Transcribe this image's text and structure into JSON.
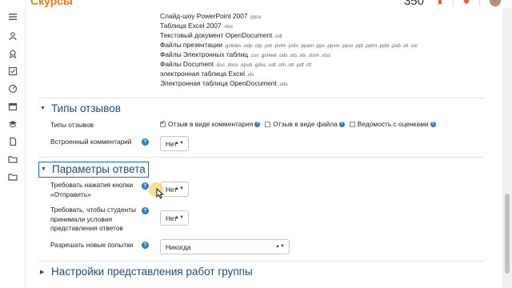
{
  "header": {
    "logo_text": "Скурсы",
    "counter": "350"
  },
  "file_types": [
    {
      "name": "Слайд-шоу PowerPoint 2007",
      "ext": ".ppsx"
    },
    {
      "name": "Таблица Excel 2007",
      "ext": ".xlsx"
    },
    {
      "name": "Текстовый документ OpenDocument",
      "ext": ".odt"
    },
    {
      "name": "Файлы презентации",
      "ext": ".gslides .odp .otp .pot .potm .potx .ppam .pps .ppsm .ppsx .ppt .pptm .pptx .pub .sti .sxi"
    },
    {
      "name": "Файлы Электронных таблиц",
      "ext": ".csv .gsheet .ods .ots .xls .xlsm .xlsx"
    },
    {
      "name": "Файлы Document",
      "ext": ".doc .docx .epub .gdoc .odt .oth .ott .pdf .rtf"
    },
    {
      "name": "электронная таблица Excel",
      "ext": ".xls"
    },
    {
      "name": "Электронная таблица OpenDocument",
      "ext": ".ods"
    }
  ],
  "feedback_section": {
    "title": "Типы отзывов",
    "types_label": "Типы отзывов",
    "options": [
      {
        "label": "Отзыв в виде комментария",
        "checked": true
      },
      {
        "label": "Отзыв в виде файла",
        "checked": false
      },
      {
        "label": "Ведомость с оценками",
        "checked": false
      }
    ],
    "inline_comment_label": "Встроенный комментарий",
    "inline_comment_value": "Нет"
  },
  "submission_section": {
    "title": "Параметры ответа",
    "require_submit_label": "Требовать нажатия кнопки «Отправить»",
    "require_submit_value": "Нет",
    "require_accept_label": "Требовать, чтобы студенты принимали условия представления ответов",
    "require_accept_value": "Нет",
    "attempts_label": "Разрешать новые попытки",
    "attempts_value": "Никогда"
  },
  "group_section": {
    "title": "Настройки представления работ группы"
  },
  "colors": {
    "accent": "#1a6fb8",
    "heading": "#1a4e7a",
    "help_icon": "#2b7cc0",
    "logo": "#f07a1d"
  }
}
